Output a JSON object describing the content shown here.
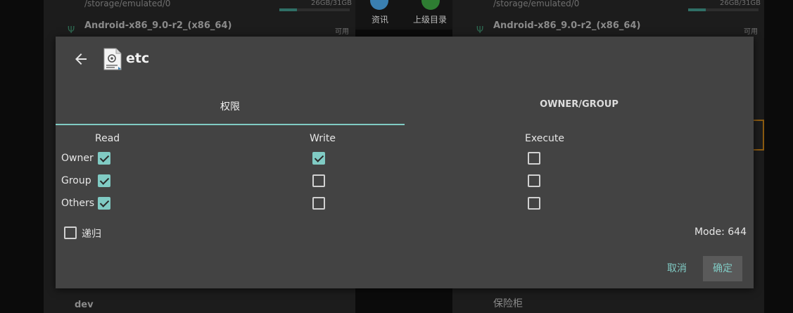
{
  "background": {
    "left_storage_path": "/storage/emulated/0",
    "left_storage_size": "26GB/31GB",
    "left_device_name": "Android-x86_9.0-r2_(x86_64)",
    "right_storage_path": "/storage/emulated/0",
    "right_storage_size": "26GB/31GB",
    "right_device_name": "Android-x86_9.0-r2_(x86_64)",
    "available_label": "可用",
    "toolbar_info_label": "资讯",
    "toolbar_up_label": "上级目录",
    "left_bottom_item": "dev",
    "right_bottom_item": "保险柜"
  },
  "dialog": {
    "title": "etc",
    "tabs": [
      {
        "label": "权限",
        "active": true
      },
      {
        "label": "OWNER/GROUP",
        "active": false
      }
    ],
    "columns": [
      "Read",
      "Write",
      "Execute"
    ],
    "rows": [
      {
        "label": "Owner",
        "read": true,
        "write": true,
        "execute": false
      },
      {
        "label": "Group",
        "read": true,
        "write": false,
        "execute": false
      },
      {
        "label": "Others",
        "read": true,
        "write": false,
        "execute": false
      }
    ],
    "recursive_label": "递归",
    "recursive_checked": false,
    "mode_text": "Mode: 644",
    "cancel_label": "取消",
    "ok_label": "确定"
  },
  "colors": {
    "accent": "#80cbc4",
    "dialog_bg": "#434343"
  }
}
